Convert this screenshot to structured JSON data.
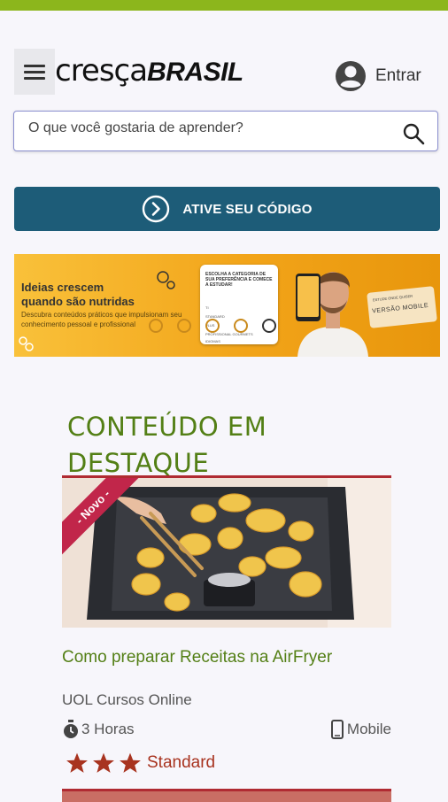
{
  "header": {
    "logo_part1": "cresça",
    "logo_part2": "BRASIL",
    "login_label": "Entrar"
  },
  "search": {
    "placeholder": "O que você gostaria de aprender?"
  },
  "cta": {
    "label": "ATIVE SEU CÓDIGO"
  },
  "banner": {
    "headline_line1": "Ideias crescem",
    "headline_line2": "quando são nutridas",
    "subtext": "Descubra conteúdos práticos que impulsionam seu conhecimento pessoal e profissional",
    "card_title": "ESCOLHA A CATEGORIA DE SUA PREFERÊNCIA E COMECE A ESTUDAR!",
    "card_items": [
      "TI",
      "STANDARD",
      "PLUS",
      "PROFISSIONAL GOURMETS",
      "IDIOMAS"
    ],
    "badge_top": "ESTUDE ONDE QUISER",
    "badge_bottom": "VERSÃO MOBILE"
  },
  "featured": {
    "title": "CONTEÚDO EM DESTAQUE",
    "courses": [
      {
        "badge": "- Novo -",
        "title": "Como preparar Receitas na AirFryer",
        "provider": "UOL Cursos Online",
        "duration": "3 Horas",
        "platform": "Mobile",
        "level": "Standard",
        "stars": 3
      }
    ]
  },
  "colors": {
    "top_bar": "#8cb61c",
    "cta_bg": "#1d5c78",
    "accent_green": "#537f15",
    "level_red": "#a8331f",
    "ribbon": "#c1264a"
  }
}
